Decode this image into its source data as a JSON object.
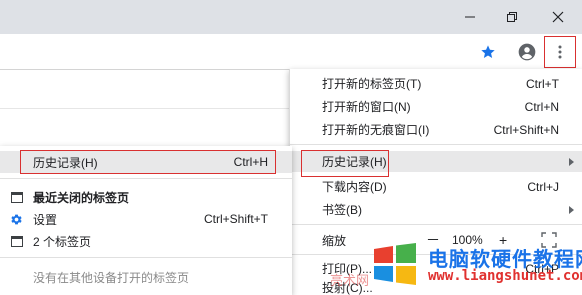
{
  "window": {
    "minimize_icon": "minimize-icon",
    "restore_icon": "restore-icon",
    "close_icon": "close-icon"
  },
  "toolbar": {
    "bookmark_icon": "star-icon",
    "profile_icon": "account-icon",
    "menu_icon": "kebab-menu-icon"
  },
  "main_menu": {
    "items": [
      {
        "label": "打开新的标签页(T)",
        "shortcut": "Ctrl+T"
      },
      {
        "label": "打开新的窗口(N)",
        "shortcut": "Ctrl+N"
      },
      {
        "label": "打开新的无痕窗口(I)",
        "shortcut": "Ctrl+Shift+N"
      },
      {
        "label": "历史记录(H)",
        "shortcut": ""
      },
      {
        "label": "下载内容(D)",
        "shortcut": "Ctrl+J"
      },
      {
        "label": "书签(B)",
        "shortcut": ""
      },
      {
        "label": "缩放",
        "shortcut": ""
      },
      {
        "label": "打印(P)...",
        "shortcut": "Ctrl+P"
      },
      {
        "label": "投射(C)...",
        "shortcut": ""
      }
    ],
    "zoom": {
      "minus": "－",
      "value": "100%",
      "plus": "+"
    }
  },
  "submenu": {
    "items": [
      {
        "label": "历史记录(H)",
        "shortcut": "Ctrl+H"
      },
      {
        "label": "最近关闭的标签页",
        "shortcut": ""
      },
      {
        "label": "设置",
        "shortcut": "Ctrl+Shift+T"
      },
      {
        "label": "2 个标签页",
        "shortcut": ""
      },
      {
        "label": "没有在其他设备打开的标签页",
        "shortcut": ""
      }
    ]
  },
  "watermark": {
    "title": "电脑软硬件教程网",
    "url": "www.liangshunet.com",
    "faint": "亮术网"
  },
  "colors": {
    "highlight_red": "#d93030",
    "menu_hover": "#e8e8e9",
    "accent_blue": "#1a73e8"
  }
}
